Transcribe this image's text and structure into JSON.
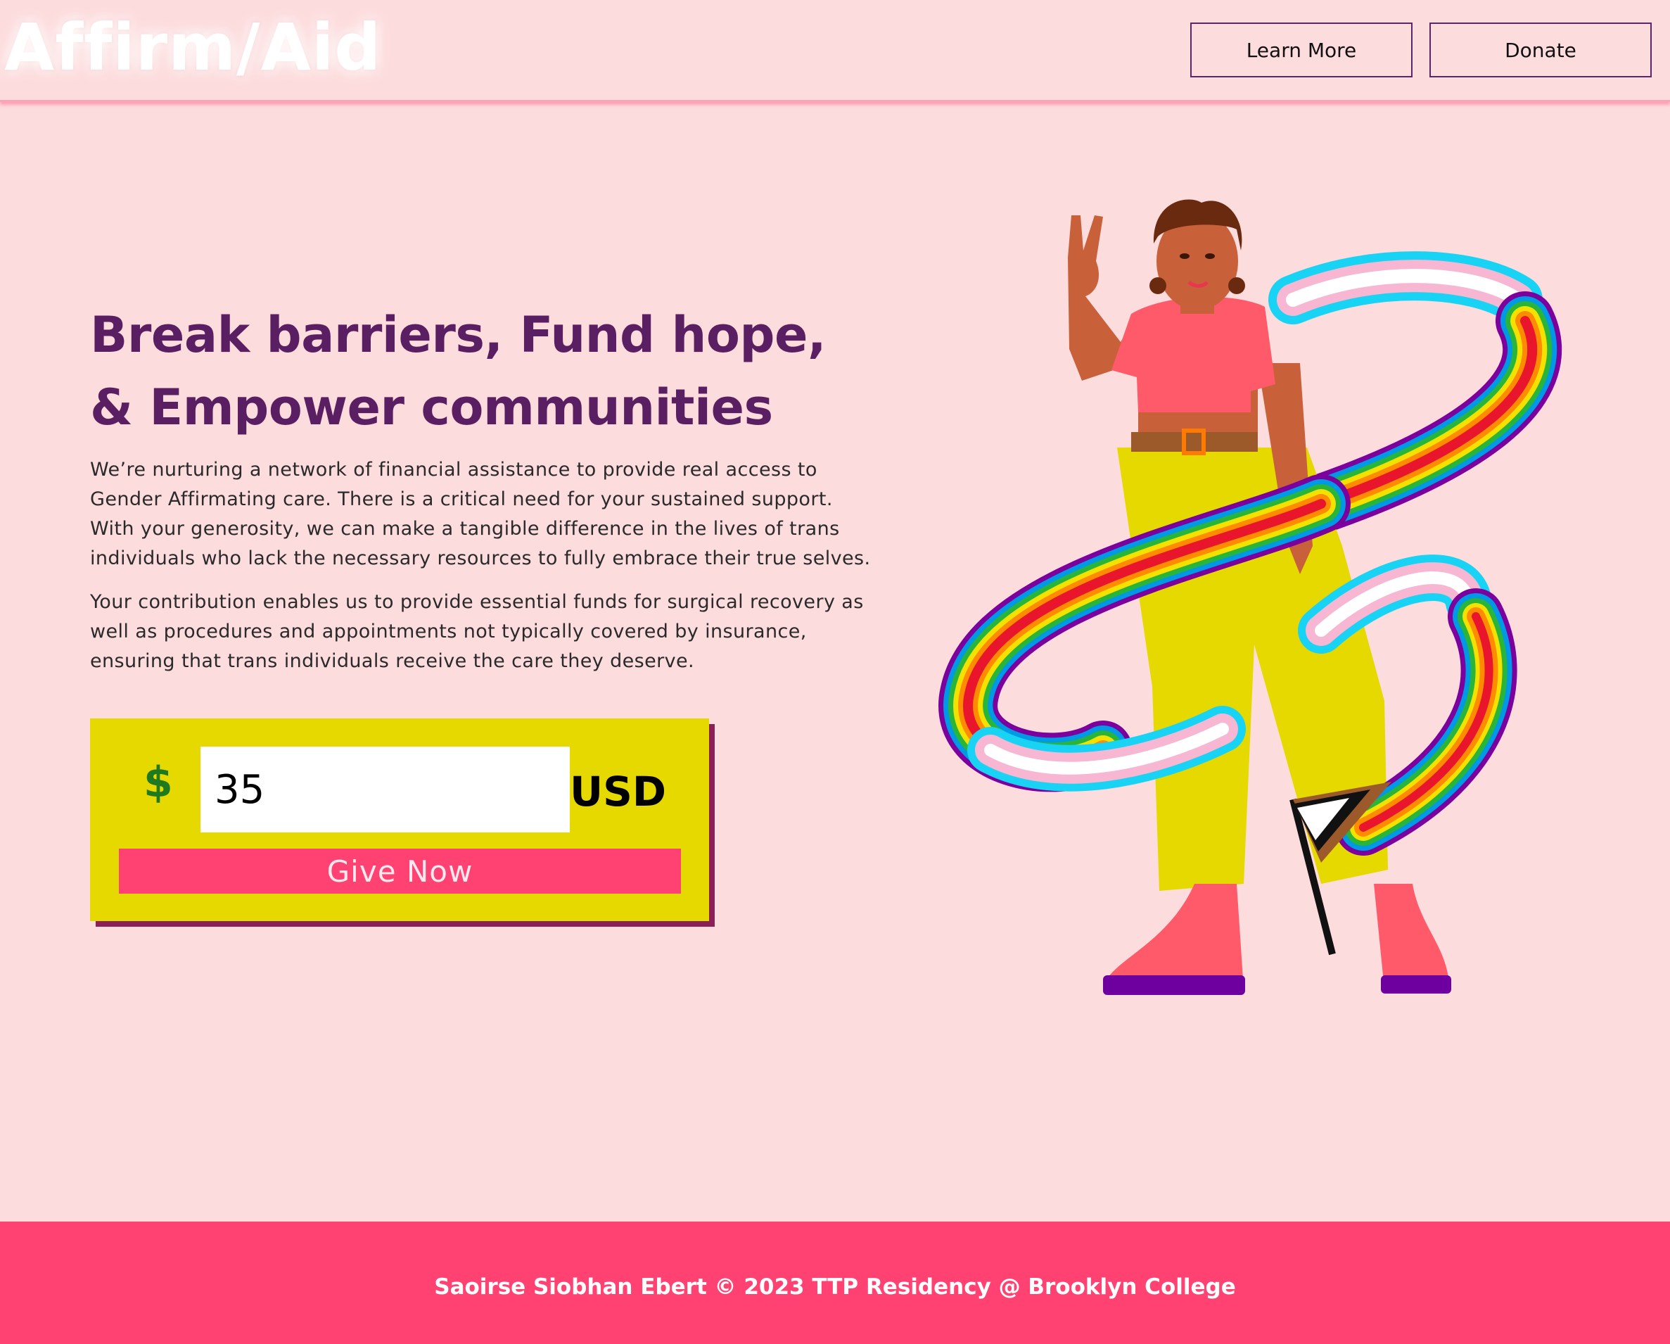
{
  "header": {
    "logo": "Affirm/Aid",
    "nav": [
      {
        "label": "Learn More"
      },
      {
        "label": "Donate"
      }
    ]
  },
  "hero": {
    "headline_line1": "Break barriers, Fund hope,",
    "headline_line2": "& Empower communities",
    "paragraph1": "We’re nurturing a network of financial assistance to provide real access to Gender Affirmating care. There is a critical need for your sustained support. With your generosity, we can make a tangible difference in the lives of trans individuals who lack the necessary resources to fully embrace their true selves.",
    "paragraph2": "Your contribution enables us to provide essential funds for surgical recovery as well as procedures and appointments not typically covered by insurance, ensuring that trans individuals receive the care they deserve."
  },
  "donation": {
    "currency_symbol": "$",
    "amount": "35",
    "currency_code": "USD",
    "button_label": "Give Now"
  },
  "illustration": {
    "icon": "person-with-pride-ribbon-illustration"
  },
  "footer": {
    "text": "Saoirse Siobhan Ebert © 2023 TTP Residency @ Brooklyn College"
  },
  "colors": {
    "background": "#fddcdd",
    "headline": "#5a1f63",
    "accent_pink": "#ff4272",
    "donate_box": "#e6d900",
    "box_shadow": "#8b1f57",
    "dollar_green": "#1f7a1f"
  }
}
